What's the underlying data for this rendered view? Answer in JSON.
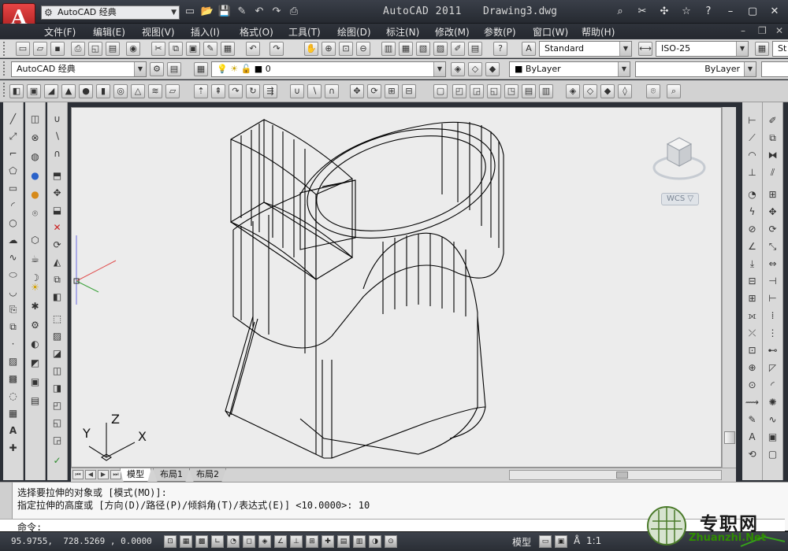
{
  "title": {
    "workspace": "AutoCAD 经典",
    "app": "AutoCAD 2011",
    "file": "Drawing3.dwg"
  },
  "menu": [
    "文件(F)",
    "编辑(E)",
    "视图(V)",
    "插入(I)",
    "格式(O)",
    "工具(T)",
    "绘图(D)",
    "标注(N)",
    "修改(M)",
    "参数(P)",
    "窗口(W)",
    "帮助(H)"
  ],
  "toolbar": {
    "text_style": "Standard",
    "dim_style": "ISO-25",
    "table_style_partial": "St",
    "workspace": "AutoCAD 经典",
    "layer": "0",
    "color": "ByLayer",
    "linetype": "ByLayer"
  },
  "viewcube": {
    "wcs_label": "WCS",
    "ucs_x": "X",
    "ucs_y": "Y",
    "ucs_z": "Z"
  },
  "layout_tabs": [
    "模型",
    "布局1",
    "布局2"
  ],
  "command": {
    "line1": "选择要拉伸的对象或 [模式(MO)]:",
    "line2": "指定拉伸的高度或 [方向(D)/路径(P)/倾斜角(T)/表达式(E)] <10.0000>: 10",
    "prompt": "命令:"
  },
  "status": {
    "coordinates": "95.9755,  728.5269 , 0.0000",
    "space": "模型",
    "scale": "1:1"
  },
  "watermark": {
    "text": "专职网",
    "site": "Zhuanzhi.Net"
  },
  "colors": {
    "canvas_bg": "#ececec",
    "titlebar": "#2b2f36",
    "accent_red": "#cc2b2b"
  }
}
